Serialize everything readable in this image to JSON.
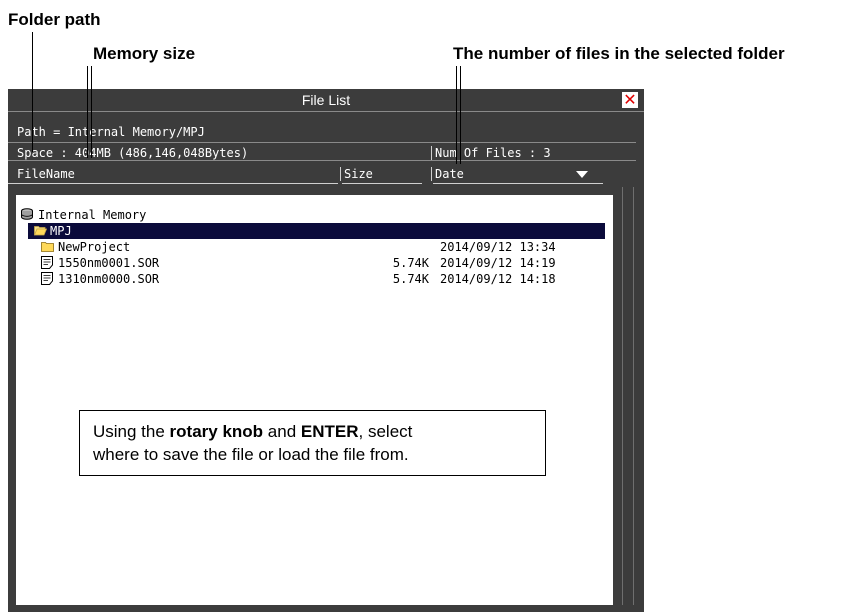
{
  "callouts": {
    "folder_path": "Folder path",
    "memory_size": "Memory size",
    "num_files": "The number of files in the selected folder"
  },
  "window": {
    "title": "File List",
    "close_label": "✕",
    "path_line": "Path = Internal Memory/MPJ",
    "space_line": "Space : 404MB (486,146,048Bytes)",
    "num_files_line": "Num Of Files : 3",
    "columns": {
      "filename": "FileName",
      "size": "Size",
      "date": "Date"
    },
    "sort_icon": "triangle-down-icon"
  },
  "tree": {
    "root": {
      "icon": "drive-icon",
      "label": "Internal Memory"
    },
    "selected_folder": {
      "icon": "folder-open-icon",
      "label": "MPJ"
    },
    "items": [
      {
        "icon": "folder-icon",
        "name": "NewProject",
        "size": "",
        "date": "2014/09/12 13:34"
      },
      {
        "icon": "file-icon",
        "name": "1550nm0001.SOR",
        "size": "5.74K",
        "date": "2014/09/12 14:19"
      },
      {
        "icon": "file-icon",
        "name": "1310nm0000.SOR",
        "size": "5.74K",
        "date": "2014/09/12 14:18"
      }
    ]
  },
  "note": {
    "l1_a": "Using the ",
    "l1_b": "rotary knob",
    "l1_c": " and ",
    "l1_d": "ENTER",
    "l1_e": ", select",
    "l2": "where to save the file or load the file from."
  },
  "colors": {
    "window_bg": "#3c3c3c",
    "selection": "#0b0b3b",
    "close": "#e00000"
  }
}
